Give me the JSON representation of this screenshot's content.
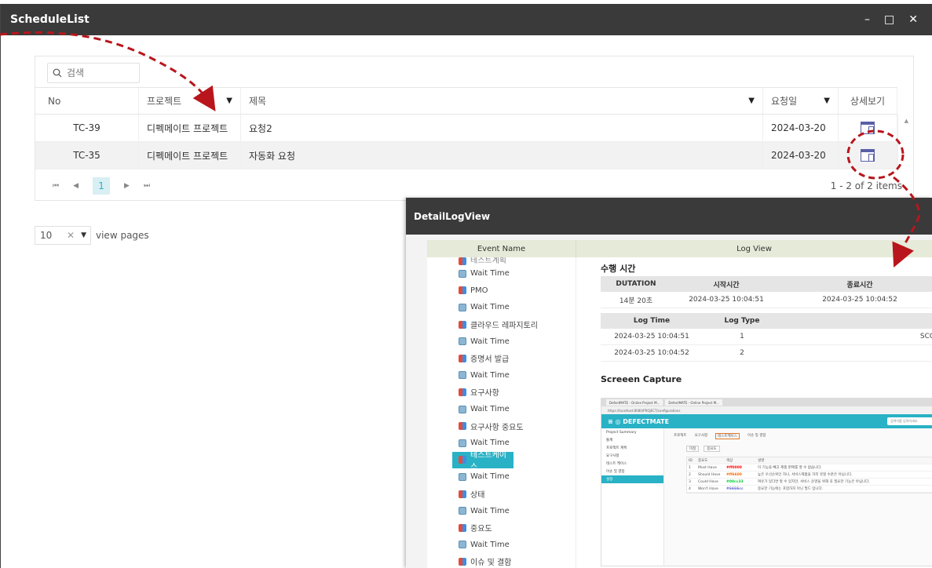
{
  "schedule_window": {
    "title": "ScheduleList",
    "controls": {
      "minimize": "–",
      "maximize": "□",
      "close": "✕"
    },
    "search_placeholder": "검색",
    "columns": {
      "no": "No",
      "project": "프로젝트",
      "title": "제목",
      "request_date": "요청일",
      "detail": "상세보기"
    },
    "rows": [
      {
        "no": "TC-39",
        "project": "디펙메이트 프로젝트",
        "title": "요청2",
        "date": "2024-03-20"
      },
      {
        "no": "TC-35",
        "project": "디펙메이트 프로젝트",
        "title": "자동화 요청",
        "date": "2024-03-20"
      }
    ],
    "pager": {
      "first": "⏮",
      "prev": "◀",
      "page": "1",
      "next": "▶",
      "last": "⏭",
      "summary": "1 - 2 of 2 items"
    },
    "page_size": {
      "value": "10",
      "clear": "✕",
      "arrow": "▼",
      "label": "view pages"
    }
  },
  "detail_window": {
    "title": "DetailLogView",
    "event_header": "Event Name",
    "log_header": "Log View",
    "events": [
      {
        "label": "테스트계획",
        "kind": "step",
        "partial": true
      },
      {
        "label": "Wait Time",
        "kind": "wait"
      },
      {
        "label": "PMO",
        "kind": "step"
      },
      {
        "label": "Wait Time",
        "kind": "wait"
      },
      {
        "label": "클라우드 레파지토리",
        "kind": "step"
      },
      {
        "label": "Wait Time",
        "kind": "wait"
      },
      {
        "label": "증명서 발급",
        "kind": "step"
      },
      {
        "label": "Wait Time",
        "kind": "wait"
      },
      {
        "label": "요구사항",
        "kind": "step"
      },
      {
        "label": "Wait Time",
        "kind": "wait"
      },
      {
        "label": "요구사항 중요도",
        "kind": "step"
      },
      {
        "label": "Wait Time",
        "kind": "wait"
      },
      {
        "label": "테스트케이스",
        "kind": "step",
        "active": true
      },
      {
        "label": "Wait Time",
        "kind": "wait"
      },
      {
        "label": "상태",
        "kind": "step"
      },
      {
        "label": "Wait Time",
        "kind": "wait"
      },
      {
        "label": "중요도",
        "kind": "step"
      },
      {
        "label": "Wait Time",
        "kind": "wait"
      },
      {
        "label": "이슈 및 결함",
        "kind": "step"
      }
    ],
    "exec_section": {
      "title": "수행 시간",
      "headers": [
        "DUTATION",
        "시작시간",
        "종료시간"
      ],
      "row": [
        "14분 20초",
        "2024-03-25 10:04:51",
        "2024-03-25 10:04:52"
      ]
    },
    "log_section": {
      "headers": [
        "Log Time",
        "Log Type",
        ""
      ],
      "rows": [
        [
          "2024-03-25 10:04:51",
          "1",
          "SCO"
        ],
        [
          "2024-03-25 10:04:52",
          "2",
          ""
        ]
      ]
    },
    "capture": {
      "title": "Screeen Capture",
      "tabs": [
        "DefectMATE - Online Project M...",
        "DefectMATE - Online Project M..."
      ],
      "url": "https://localhost:8080/PROJECT/configurations",
      "brand": "≡  ◎ DEFECTMATE",
      "search_placeholder": "검색어를 입력하세요",
      "side": [
        "Project Summary",
        "통계",
        "프로젝트 계획",
        "요구사항",
        "테스트 케이스",
        "이슈 및 결함",
        "설정"
      ],
      "tabbar": [
        "프로젝트",
        "요구사항",
        "테스트케이스",
        "이슈 및 결함"
      ],
      "subtabs": [
        "미정",
        "중요도"
      ],
      "grid": [
        [
          "ID",
          "중요도",
          "색상",
          "설명"
        ],
        [
          "1",
          "Must Have",
          "#ff0000",
          "이 기능을 빼고 제품 판매를 할 수 없습니다."
        ],
        [
          "2",
          "Should Have",
          "#ff6600",
          "높은 우선순위인 하나, 서비스제품을 하지 못할 수준은 아닙니다."
        ],
        [
          "3",
          "Could Have",
          "#00cc33",
          "여유가 있다면 할 수 있지만, 서비스 운영을 위해 꼭 필요한 기능은 아닙니다."
        ],
        [
          "4",
          "Won't Have",
          "#6666cc",
          "중요한 기능에는 포함하지 아닌 필드 입니다."
        ]
      ]
    }
  },
  "colors": {
    "accent": "#29b2c6",
    "titlebar": "#3a3a3a",
    "annotation": "#b8161c"
  }
}
